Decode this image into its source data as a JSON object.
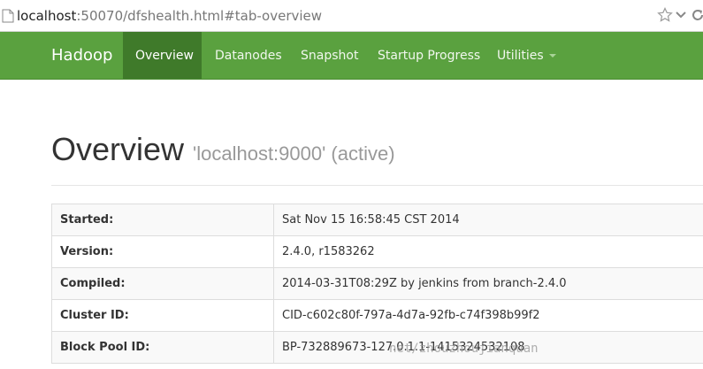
{
  "browser": {
    "url_host": "localhost",
    "url_rest": ":50070/dfshealth.html#tab-overview"
  },
  "navbar": {
    "brand": "Hadoop",
    "items": [
      {
        "label": "Overview",
        "active": true
      },
      {
        "label": "Datanodes"
      },
      {
        "label": "Snapshot"
      },
      {
        "label": "Startup Progress"
      },
      {
        "label": "Utilities"
      }
    ]
  },
  "page": {
    "title": "Overview",
    "subtitle": "'localhost:9000' (active)"
  },
  "info_table": {
    "rows": [
      {
        "key": "Started:",
        "value": "Sat Nov 15 16:58:45 CST 2014"
      },
      {
        "key": "Version:",
        "value": "2.4.0, r1583262"
      },
      {
        "key": "Compiled:",
        "value": "2014-03-31T08:29Z by jenkins from branch-2.4.0"
      },
      {
        "key": "Cluster ID:",
        "value": "CID-c602c80f-797a-4d7a-92fb-c74f398b99f2"
      },
      {
        "key": "Block Pool ID:",
        "value": "BP-732889673-127.0.1.1-1415324532108"
      }
    ]
  },
  "watermark": "net/zhouzhoujianquan",
  "colors": {
    "navbar": "#5aa13f",
    "navbar_active": "#3f7a2a"
  }
}
